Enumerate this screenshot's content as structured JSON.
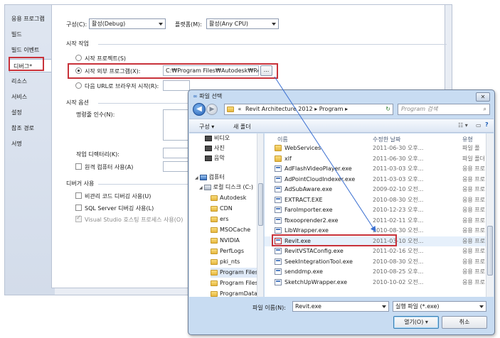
{
  "vs": {
    "tabs": [
      {
        "label": "응용 프로그램"
      },
      {
        "label": "빌드"
      },
      {
        "label": "빌드 이벤트"
      },
      {
        "label": "디버그*"
      },
      {
        "label": "리소스"
      },
      {
        "label": "서비스"
      },
      {
        "label": "설정"
      },
      {
        "label": "참조 경로"
      },
      {
        "label": "서명"
      }
    ],
    "config_label": "구성(C):",
    "config_value": "활성(Debug)",
    "platform_label": "플랫폼(M):",
    "platform_value": "활성(Any CPU)",
    "start_action_header": "시작 작업",
    "start_project": "시작 프로젝트(S)",
    "start_external": "시작 외부 프로그램(X):",
    "external_path": "C:₩Program Files₩Autodesk₩Revit A",
    "browse_label": "...",
    "start_browser": "다음 URL로 브라우저 시작(R):",
    "start_options_header": "시작 옵션",
    "cmd_args": "명령줄 인수(N):",
    "work_dir": "작업 디렉터리(K):",
    "remote_machine": "원격 컴퓨터 사용(A)",
    "debuggers_header": "디버거 사용",
    "unmanaged": "비관리 코드 디버깅 사용(U)",
    "sql": "SQL Server 디버깅 사용(L)",
    "vs_hosting": "Visual Studio 호스팅 프로세스 사용(O)"
  },
  "dialog": {
    "title": "파일 선택",
    "close": "✕",
    "address_prefix": "«",
    "address_parts": [
      "Revit Architecture 2012",
      "Program"
    ],
    "search_placeholder": "Program 검색",
    "organize": "구성 ▾",
    "new_folder": "새 폴더",
    "nav": [
      {
        "label": "비디오",
        "icon": "video-icon"
      },
      {
        "label": "사진",
        "icon": "photo-icon"
      },
      {
        "label": "음악",
        "icon": "music-icon"
      },
      {
        "label": "컴퓨터",
        "icon": "computer-icon"
      },
      {
        "label": "로컬 디스크 (C:)",
        "icon": "drive-icon"
      },
      {
        "label": "Autodesk",
        "icon": "folder-icon"
      },
      {
        "label": "CDN",
        "icon": "folder-icon"
      },
      {
        "label": "ers",
        "icon": "folder-icon"
      },
      {
        "label": "MSOCache",
        "icon": "folder-icon"
      },
      {
        "label": "NVIDIA",
        "icon": "folder-icon"
      },
      {
        "label": "PerfLogs",
        "icon": "folder-icon"
      },
      {
        "label": "pki_nts",
        "icon": "folder-icon"
      },
      {
        "label": "Program Files",
        "icon": "folder-icon"
      },
      {
        "label": "Program Files (",
        "icon": "folder-icon"
      },
      {
        "label": "ProgramData",
        "icon": "folder-icon"
      }
    ],
    "columns": {
      "name": "이름",
      "date": "수정한 날짜",
      "type": "유형"
    },
    "files": [
      {
        "name": "WebServices",
        "date": "2011-06-30 오후...",
        "type": "파일 폴",
        "kind": "folder"
      },
      {
        "name": "xlf",
        "date": "2011-06-30 오후...",
        "type": "파일 폴더",
        "kind": "folder"
      },
      {
        "name": "AdFlashVideoPlayer.exe",
        "date": "2011-03-03 오후...",
        "type": "응용 프로",
        "kind": "exe"
      },
      {
        "name": "AdPointCloudIndexer.exe",
        "date": "2011-03-03 오후...",
        "type": "응용 프로",
        "kind": "exe"
      },
      {
        "name": "AdSubAware.exe",
        "date": "2009-02-10 오전...",
        "type": "응용 프로",
        "kind": "exe"
      },
      {
        "name": "EXTRACT.EXE",
        "date": "2010-08-30 오전...",
        "type": "응용 프로",
        "kind": "exe"
      },
      {
        "name": "FaroImporter.exe",
        "date": "2010-12-23 오후...",
        "type": "응용 프로",
        "kind": "exe"
      },
      {
        "name": "fbxooprender2.exe",
        "date": "2011-02-11 오후...",
        "type": "응용 프로",
        "kind": "exe"
      },
      {
        "name": "LibWrapper.exe",
        "date": "2010-08-30 오전...",
        "type": "응용 프로",
        "kind": "exe"
      },
      {
        "name": "Revit.exe",
        "date": "2011-03-10 오전...",
        "type": "응용 프로",
        "kind": "revit"
      },
      {
        "name": "RevitVSTAConfig.exe",
        "date": "2011-02-16 오전...",
        "type": "응용 프로",
        "kind": "exe"
      },
      {
        "name": "SeekIntegrationTool.exe",
        "date": "2010-08-30 오전...",
        "type": "응용 프로",
        "kind": "exe"
      },
      {
        "name": "senddmp.exe",
        "date": "2010-08-25 오후...",
        "type": "응용 프로",
        "kind": "exe"
      },
      {
        "name": "SketchUpWrapper.exe",
        "date": "2010-10-02 오전...",
        "type": "응용 프로",
        "kind": "exe"
      }
    ],
    "filename_label": "파일 이름(N):",
    "filename_value": "Revit.exe",
    "filetype_value": "실행 파일 (*.exe)",
    "open_button": "열기(O)",
    "cancel_button": "취소"
  },
  "colors": {
    "highlight_border": "#c8323a",
    "arrow": "#3a6fd1"
  }
}
